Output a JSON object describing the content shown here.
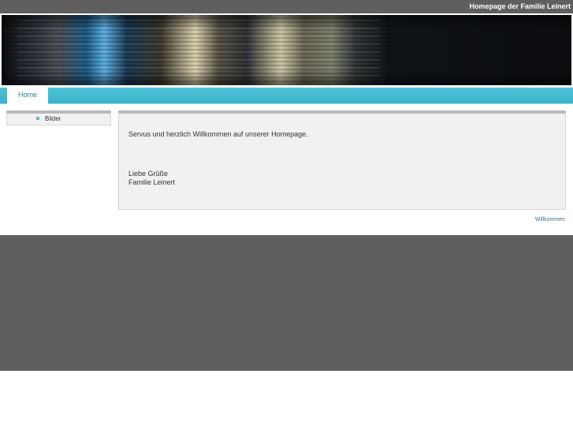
{
  "header": {
    "site_title": "Homepage der Familie Leinert"
  },
  "nav": {
    "tabs": [
      {
        "label": "Home",
        "active": true
      }
    ]
  },
  "sidebar": {
    "items": [
      {
        "label": "Bilder"
      }
    ]
  },
  "main": {
    "welcome_text": "Servus und herzlich Willkommen auf unserer Homepage.",
    "greeting": "Liebe Grüße",
    "signature": "Familie Leinert"
  },
  "footer": {
    "link_text": "Willkommen"
  },
  "colors": {
    "top_bar": "#5f5f5f",
    "nav_accent": "#4fc2d7",
    "panel_bg": "#f1f1f1",
    "bullet": "#57bad2"
  },
  "icons": {
    "sidebar_bullet": "square-bullet-icon"
  }
}
